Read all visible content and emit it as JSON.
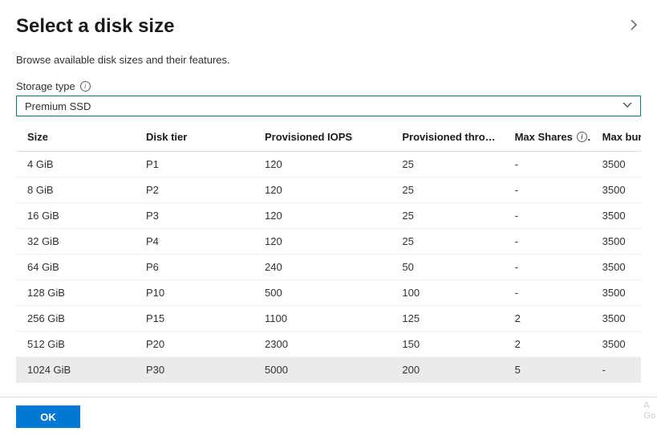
{
  "header": {
    "title": "Select a disk size"
  },
  "subtitle": "Browse available disk sizes and their features.",
  "storageType": {
    "label": "Storage type",
    "value": "Premium SSD"
  },
  "table": {
    "columns": {
      "size": "Size",
      "tier": "Disk tier",
      "iops": "Provisioned IOPS",
      "throughput": "Provisioned thro…",
      "maxShares": "Max Shares",
      "maxBurst": "Max bur"
    },
    "rows": [
      {
        "size": "4 GiB",
        "tier": "P1",
        "iops": "120",
        "throughput": "25",
        "maxShares": "-",
        "maxBurst": "3500"
      },
      {
        "size": "8 GiB",
        "tier": "P2",
        "iops": "120",
        "throughput": "25",
        "maxShares": "-",
        "maxBurst": "3500"
      },
      {
        "size": "16 GiB",
        "tier": "P3",
        "iops": "120",
        "throughput": "25",
        "maxShares": "-",
        "maxBurst": "3500"
      },
      {
        "size": "32 GiB",
        "tier": "P4",
        "iops": "120",
        "throughput": "25",
        "maxShares": "-",
        "maxBurst": "3500"
      },
      {
        "size": "64 GiB",
        "tier": "P6",
        "iops": "240",
        "throughput": "50",
        "maxShares": "-",
        "maxBurst": "3500"
      },
      {
        "size": "128 GiB",
        "tier": "P10",
        "iops": "500",
        "throughput": "100",
        "maxShares": "-",
        "maxBurst": "3500"
      },
      {
        "size": "256 GiB",
        "tier": "P15",
        "iops": "1100",
        "throughput": "125",
        "maxShares": "2",
        "maxBurst": "3500"
      },
      {
        "size": "512 GiB",
        "tier": "P20",
        "iops": "2300",
        "throughput": "150",
        "maxShares": "2",
        "maxBurst": "3500"
      },
      {
        "size": "1024 GiB",
        "tier": "P30",
        "iops": "5000",
        "throughput": "200",
        "maxShares": "5",
        "maxBurst": "-"
      }
    ],
    "selectedIndex": 8
  },
  "footer": {
    "okLabel": "OK"
  },
  "watermark": {
    "line1": "A",
    "line2": "Go"
  }
}
